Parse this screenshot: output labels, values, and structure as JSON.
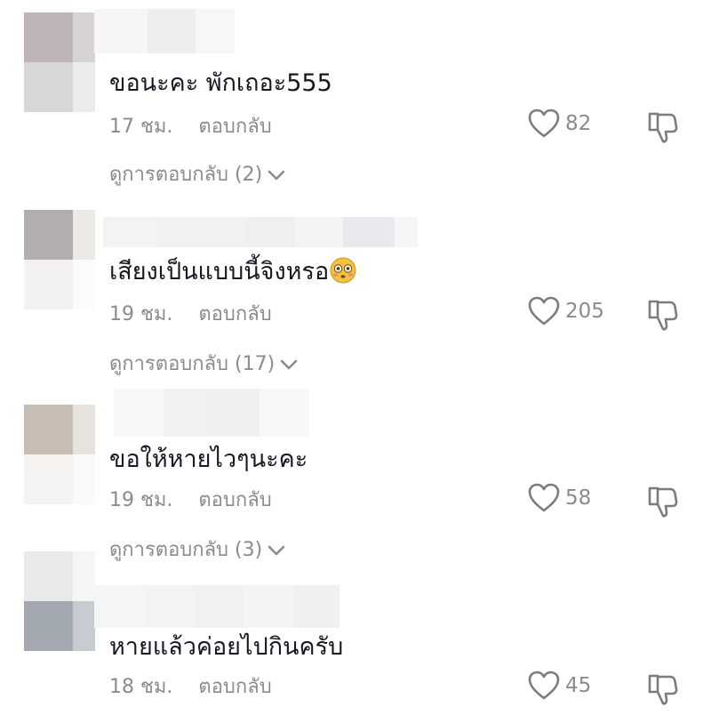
{
  "comments": [
    {
      "text": "ขอนะคะ พักเถอะ555",
      "emoji": "",
      "time": "17 ชม.",
      "reply_label": "ตอบกลับ",
      "likes": "82",
      "view_replies": "ดูการตอบกลับ (2)",
      "liked": false
    },
    {
      "text": "เสียงเป็นแบบนี้จิงหรอ",
      "emoji": "flushed-face",
      "time": "19 ชม.",
      "reply_label": "ตอบกลับ",
      "likes": "205",
      "view_replies": "ดูการตอบกลับ (17)",
      "liked": false
    },
    {
      "text": "ขอให้หายไวๆนะคะ",
      "emoji": "",
      "time": "19 ชม.",
      "reply_label": "ตอบกลับ",
      "likes": "58",
      "view_replies": "ดูการตอบกลับ (3)",
      "liked": false
    },
    {
      "text": "หายแล้วค่อยไปกินครับ",
      "emoji": "",
      "time": "18 ชม.",
      "reply_label": "ตอบกลับ",
      "likes": "45",
      "view_replies": "",
      "liked": false
    }
  ],
  "colors": {
    "text_primary": "#161823",
    "text_secondary": "#8a8b91",
    "icon_stroke": "#7b7c82",
    "background": "#ffffff"
  },
  "icons": {
    "like": "heart-outline-icon",
    "dislike": "thumbs-down-outline-icon",
    "expand": "chevron-down-icon"
  }
}
